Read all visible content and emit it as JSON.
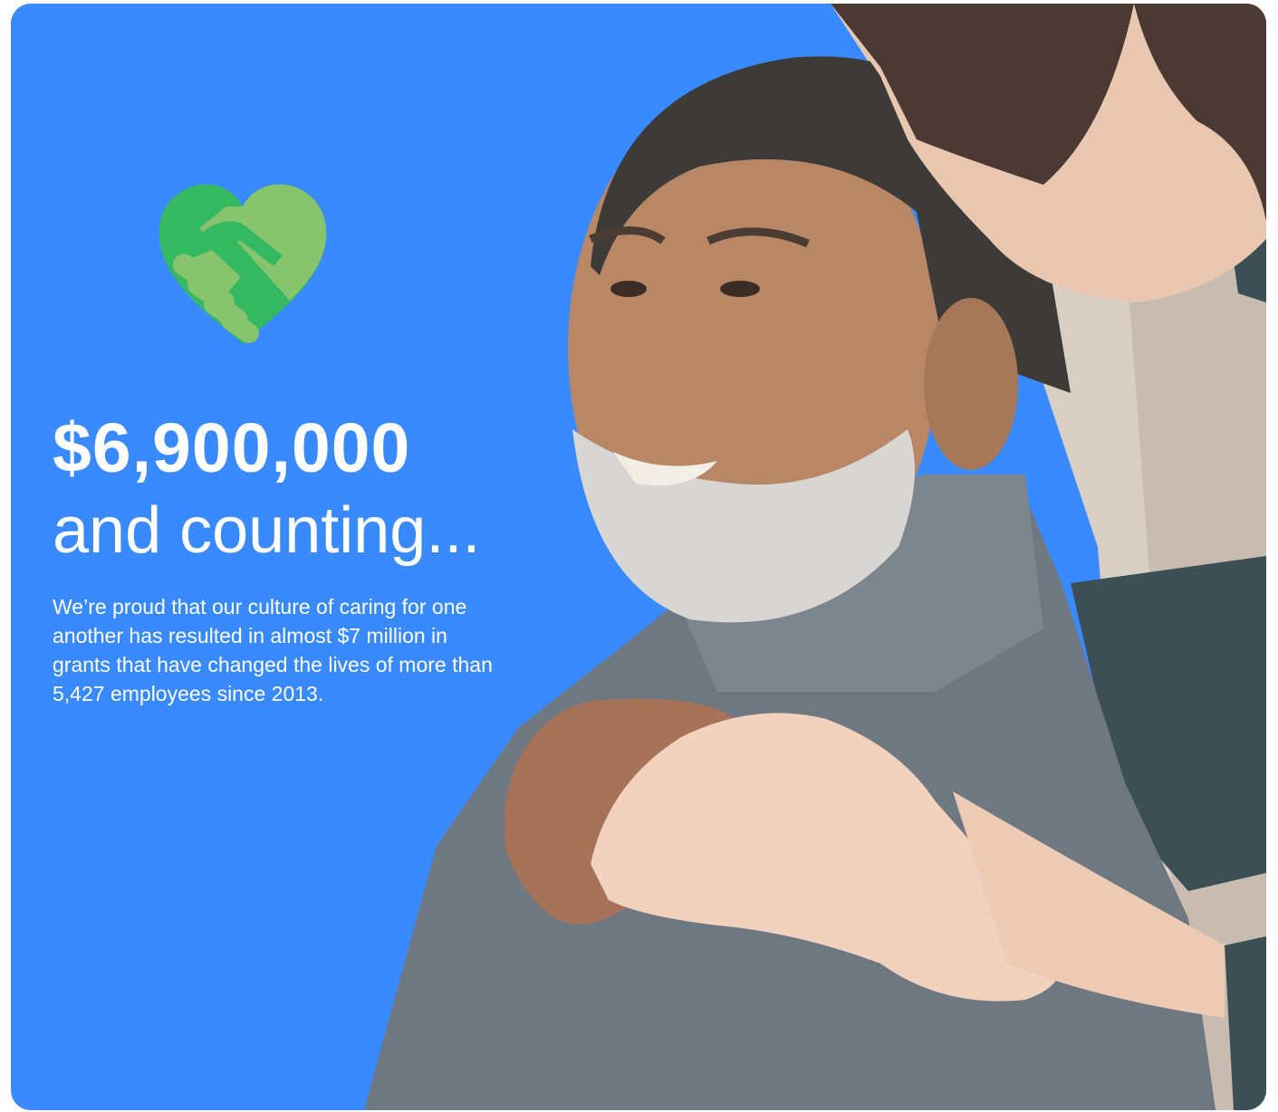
{
  "colors": {
    "card_background": "#3a8aff",
    "text": "#ffffff",
    "heart_dark_green": "#34b862",
    "heart_light_green": "#88c46e"
  },
  "icon": "heart-handshake-icon",
  "headline": {
    "amount": "$6,900,000",
    "caption": "and counting..."
  },
  "body": "We’re proud that our culture of caring for one another has resulted in almost $7 million in grants that have changed the lives of more than 5,427 employees since 2013.",
  "photo": {
    "subject": "photo"
  }
}
